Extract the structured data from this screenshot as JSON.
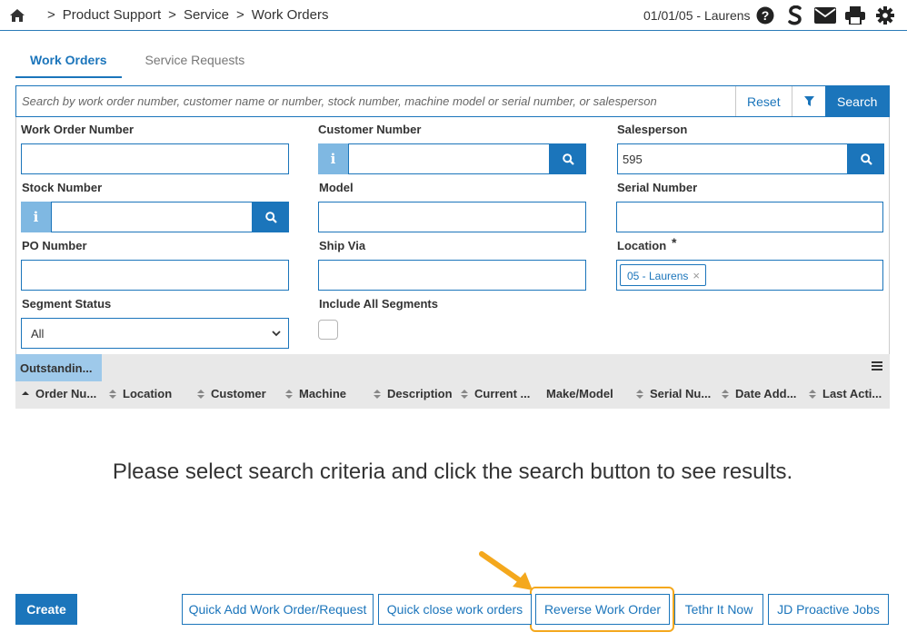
{
  "breadcrumb": {
    "items": [
      "Product Support",
      "Service",
      "Work Orders"
    ],
    "separator": ">"
  },
  "session": {
    "text": "01/01/05 - Laurens"
  },
  "header_icons": [
    "help-icon",
    "s-logo-icon",
    "mail-icon",
    "print-icon",
    "settings-icon"
  ],
  "tabs": [
    {
      "label": "Work Orders",
      "active": true
    },
    {
      "label": "Service Requests",
      "active": false
    }
  ],
  "search": {
    "placeholder": "Search by work order number, customer name or number, stock number, machine model or serial number, or salesperson",
    "reset_label": "Reset",
    "search_label": "Search"
  },
  "form": {
    "work_order_number": {
      "label": "Work Order Number",
      "value": ""
    },
    "customer_number": {
      "label": "Customer Number",
      "value": ""
    },
    "salesperson": {
      "label": "Salesperson",
      "value": "595"
    },
    "stock_number": {
      "label": "Stock Number",
      "value": ""
    },
    "model": {
      "label": "Model",
      "value": ""
    },
    "serial_number": {
      "label": "Serial Number",
      "value": ""
    },
    "po_number": {
      "label": "PO Number",
      "value": ""
    },
    "ship_via": {
      "label": "Ship Via",
      "value": ""
    },
    "location": {
      "label": "Location",
      "required_mark": "*",
      "tag": "05 - Laurens",
      "tag_remove": "×"
    },
    "segment_status": {
      "label": "Segment Status",
      "value": "All"
    },
    "include_all_segments": {
      "label": "Include All Segments",
      "checked": false
    }
  },
  "grid": {
    "tab_label": "Outstandin...",
    "columns": [
      "Order Nu...",
      "Location",
      "Customer",
      "Machine",
      "Description",
      "Current ...",
      "Make/Model",
      "Serial Nu...",
      "Date Add...",
      "Last Acti..."
    ]
  },
  "empty_message": "Please select search criteria and click the search button to see results.",
  "footer": {
    "create_label": "Create",
    "buttons": [
      "Quick Add Work Order/Request",
      "Quick close work orders",
      "Reverse Work Order",
      "Tethr It Now",
      "JD Proactive Jobs"
    ],
    "highlighted": "Reverse Work Order"
  },
  "colors": {
    "primary": "#1b75bb",
    "info_button": "#7fb8e2",
    "highlight": "#f4a81d",
    "grid_header": "#e8e8e8"
  }
}
